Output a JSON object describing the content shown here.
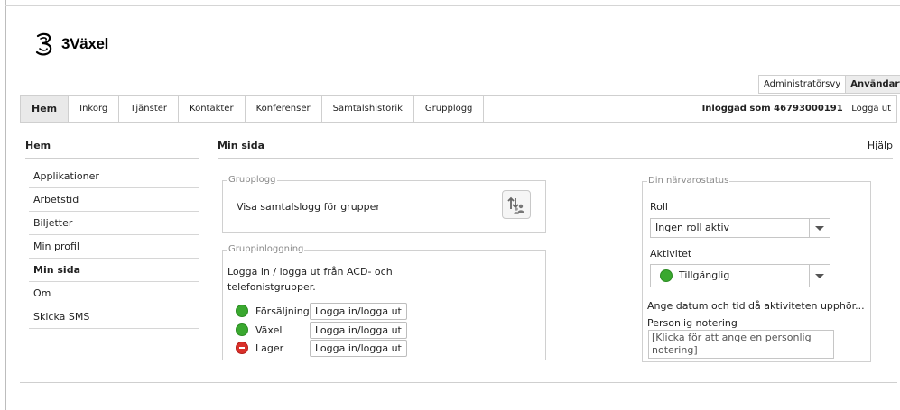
{
  "brand": {
    "name": "3Växel"
  },
  "view_switch": {
    "admin": "Administratörsvy",
    "user": "Användarvy"
  },
  "topnav": {
    "tabs": [
      "Hem",
      "Inkorg",
      "Tjänster",
      "Kontakter",
      "Konferenser",
      "Samtalshistorik",
      "Grupplogg"
    ],
    "logged_in_label": "Inloggad som 46793000191",
    "logout": "Logga ut"
  },
  "sidebar": {
    "heading": "Hem",
    "items": [
      "Applikationer",
      "Arbetstid",
      "Biljetter",
      "Min profil",
      "Min sida",
      "Om",
      "Skicka SMS"
    ]
  },
  "main": {
    "title": "Min sida",
    "help": "Hjälp"
  },
  "grupplogg": {
    "legend": "Grupplogg",
    "text": "Visa samtalslogg för grupper",
    "icon": "group-log-icon"
  },
  "gruppinloggning": {
    "legend": "Gruppinloggning",
    "description": "Logga in / logga ut från ACD- och telefonistgrupper.",
    "groups": [
      {
        "name": "Försäljning",
        "status": "green",
        "button": "Logga in/logga ut"
      },
      {
        "name": "Växel",
        "status": "green",
        "button": "Logga in/logga ut"
      },
      {
        "name": "Lager",
        "status": "red",
        "button": "Logga in/logga ut"
      }
    ]
  },
  "presence": {
    "legend": "Din närvarostatus",
    "role_label": "Roll",
    "role_value": "Ingen roll aktiv",
    "activity_label": "Aktivitet",
    "activity_value": "Tillgänglig",
    "activity_color": "#3aa82f",
    "end_time_link": "Ange datum och tid då aktiviteten upphör...",
    "note_label": "Personlig notering",
    "note_placeholder": "[Klicka för att ange en personlig notering]"
  }
}
